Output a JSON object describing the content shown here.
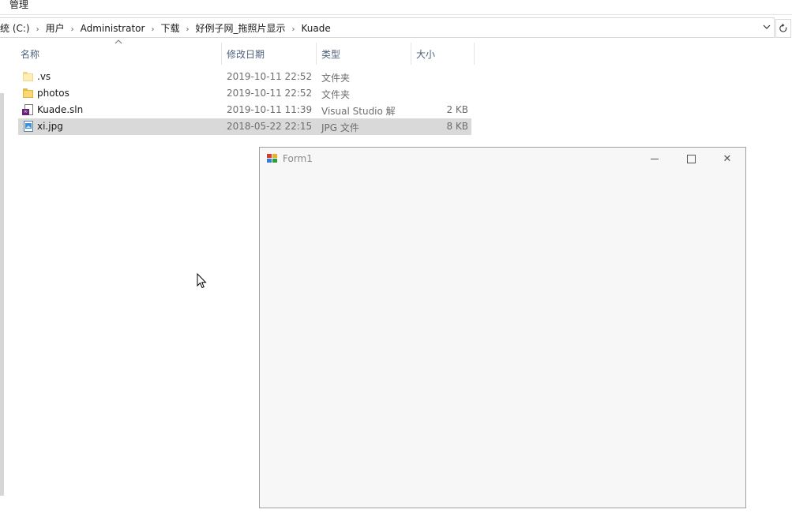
{
  "ribbon": {
    "tab_label": "管理"
  },
  "address": {
    "crumbs": [
      "统 (C:)",
      "用户",
      "Administrator",
      "下载",
      "好例子网_拖照片显示",
      "Kuade"
    ],
    "separator": "›",
    "dropdown_icon": "chevron-down-icon",
    "refresh_icon": "refresh-icon"
  },
  "columns": {
    "name": "名称",
    "date": "修改日期",
    "type": "类型",
    "size": "大小",
    "sort_icon": "sort-up-icon"
  },
  "files": [
    {
      "name": ".vs",
      "date": "2019-10-11 22:52",
      "type": "文件夹",
      "size": "",
      "icon": "folder-light-icon",
      "selected": false
    },
    {
      "name": "photos",
      "date": "2019-10-11 22:52",
      "type": "文件夹",
      "size": "",
      "icon": "folder-icon",
      "selected": false
    },
    {
      "name": "Kuade.sln",
      "date": "2019-10-11 11:39",
      "type": "Visual Studio 解",
      "size": "2 KB",
      "icon": "visual-studio-solution-icon",
      "selected": false
    },
    {
      "name": "xi.jpg",
      "date": "2018-05-22 22:15",
      "type": "JPG 文件",
      "size": "8 KB",
      "icon": "jpg-image-icon",
      "selected": true
    }
  ],
  "form": {
    "title": "Form1",
    "minimize_glyph": "",
    "maximize_glyph": "",
    "close_glyph": "✕"
  },
  "colors": {
    "selected_row": "#d9d9d9",
    "header_text": "#4c607a",
    "form_background": "#f7f7f7"
  }
}
